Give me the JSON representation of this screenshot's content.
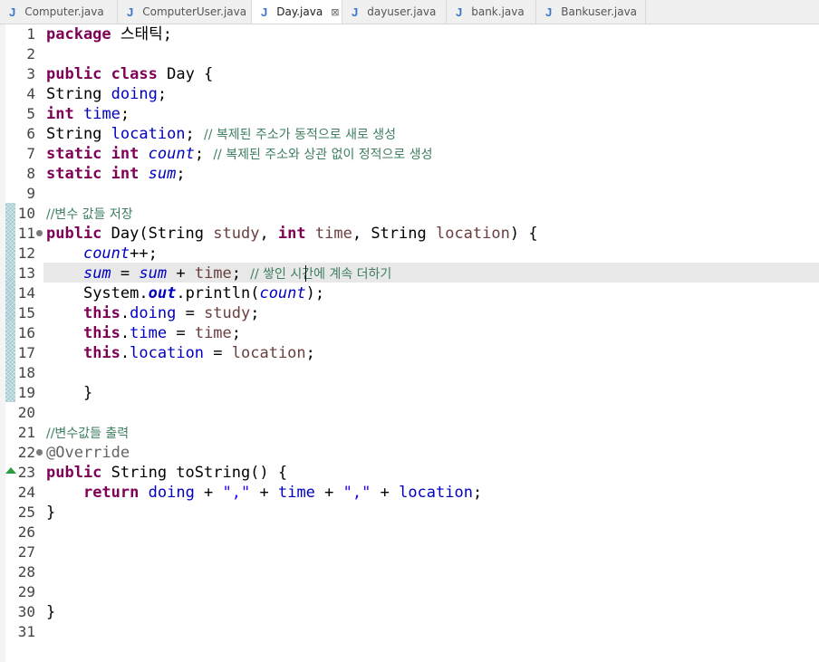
{
  "tabs": [
    {
      "label": "Computer.java",
      "active": false,
      "closable": false
    },
    {
      "label": "ComputerUser.java",
      "active": false,
      "closable": false
    },
    {
      "label": "Day.java",
      "active": true,
      "closable": true
    },
    {
      "label": "dayuser.java",
      "active": false,
      "closable": false
    },
    {
      "label": "bank.java",
      "active": false,
      "closable": false
    },
    {
      "label": "Bankuser.java",
      "active": false,
      "closable": false
    }
  ],
  "tab_icon": "J",
  "tab_close_glyph": "⊠",
  "colors": {
    "keyword": "#7f0055",
    "field": "#0000c0",
    "comment": "#3f7f5f",
    "string": "#2a00ff",
    "parameter": "#6a3e3e",
    "annotation": "#646464",
    "java_icon": "#3d78c4",
    "change_marker": "#9fc7ce",
    "override_marker": "#2a9d3a"
  },
  "current_line": 13,
  "code": {
    "l1": {
      "kw": "package",
      "rest": " 스태틱;"
    },
    "l3": {
      "kw1": "public",
      "kw2": "class",
      "rest": " Day {"
    },
    "l4": {
      "type": "String ",
      "field": "doing",
      "end": ";"
    },
    "l5": {
      "kw": "int",
      "field": "time",
      "end": ";"
    },
    "l6": {
      "type": "String ",
      "field": "location",
      "end": "; ",
      "comment": "// 복제된 주소가 동적으로 새로 생성"
    },
    "l7": {
      "kw1": "static",
      "kw2": "int",
      "field": "count",
      "end": "; ",
      "comment": "// 복제된 주소와 상관 없이 정적으로 생성"
    },
    "l8": {
      "kw1": "static",
      "kw2": "int",
      "field": "sum",
      "end": ";"
    },
    "l10": {
      "comment": "//변수 값들 저장"
    },
    "l11": {
      "kw": "public",
      "a": " Day(String ",
      "p1": "study",
      "b": ", ",
      "kw2": "int",
      "p2": "time",
      "c": ", String ",
      "p3": "location",
      "d": ") {"
    },
    "l12": {
      "field": "count",
      "end": "++;"
    },
    "l13": {
      "field1": "sum",
      "eq": " = ",
      "field2": "sum",
      "plus": " + ",
      "param": "time",
      "end": "; ",
      "comment": "// 쌓인 시간에 계속 더하기"
    },
    "l14": {
      "a": "System.",
      "out": "out",
      "b": ".println(",
      "field": "count",
      "c": ");"
    },
    "l15": {
      "kw": "this",
      "dot": ".",
      "field": "doing",
      "eq": " = ",
      "param": "study",
      "end": ";"
    },
    "l16": {
      "kw": "this",
      "dot": ".",
      "field": "time",
      "eq": " = ",
      "param": "time",
      "end": ";"
    },
    "l17": {
      "kw": "this",
      "dot": ".",
      "field": "location",
      "eq": " = ",
      "param": "location",
      "end": ";"
    },
    "l19": {
      "text": "}"
    },
    "l21": {
      "comment": "//변수값들 출력"
    },
    "l22": {
      "ann": "@Override"
    },
    "l23": {
      "kw": "public",
      "rest": " String toString() {"
    },
    "l24": {
      "kw": "return",
      "f1": "doing",
      "p1": " + ",
      "s1": "\",\"",
      "p2": " + ",
      "f2": "time",
      "p3": " + ",
      "s2": "\",\"",
      "p4": " + ",
      "f3": "location",
      "end": ";"
    },
    "l25": {
      "text": "}"
    },
    "l30": {
      "text": "}"
    }
  }
}
